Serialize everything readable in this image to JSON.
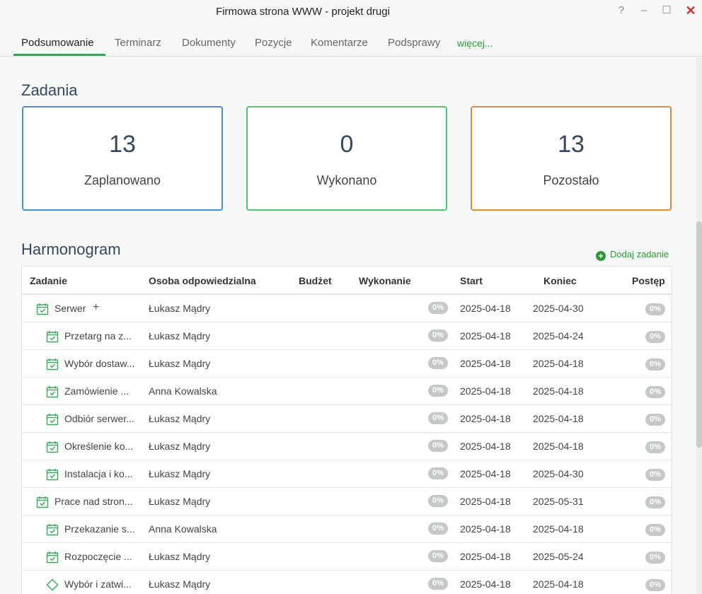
{
  "window": {
    "title": "Firmowa strona WWW - projekt drugi",
    "help": "?",
    "minimize": "–",
    "maximize": "☐",
    "close": "✕"
  },
  "tabs": {
    "items": [
      {
        "label": "Podsumowanie",
        "active": true
      },
      {
        "label": "Terminarz"
      },
      {
        "label": "Dokumenty"
      },
      {
        "label": "Pozycje"
      },
      {
        "label": "Komentarze"
      },
      {
        "label": "Podsprawy"
      }
    ],
    "more": "więcej..."
  },
  "tasks_section": {
    "title": "Zadania",
    "cards": [
      {
        "value": "13",
        "label": "Zaplanowano",
        "color": "#4a90c2"
      },
      {
        "value": "0",
        "label": "Wykonano",
        "color": "#54c06a"
      },
      {
        "value": "13",
        "label": "Pozostało",
        "color": "#d98a3a"
      }
    ]
  },
  "schedule": {
    "title": "Harmonogram",
    "add_task": "Dodaj zadanie",
    "columns": [
      "Zadanie",
      "Osoba odpowiedzialna",
      "Budżet",
      "Wykonanie",
      "Start",
      "Koniec",
      "Postęp"
    ],
    "rows": [
      {
        "name": "Serwer",
        "person": "Łukasz Mądry",
        "exec": "0%",
        "start": "2025-04-18",
        "end": "2025-04-30",
        "progress": "0%",
        "level": 0,
        "icon": "calendar-check-icon",
        "has_add": true,
        "add": "+"
      },
      {
        "name": "Przetarg na z...",
        "person": "Łukasz Mądry",
        "exec": "0%",
        "start": "2025-04-18",
        "end": "2025-04-24",
        "progress": "0%",
        "level": 1,
        "icon": "calendar-check-icon"
      },
      {
        "name": "Wybór dostaw...",
        "person": "Łukasz Mądry",
        "exec": "0%",
        "start": "2025-04-18",
        "end": "2025-04-18",
        "progress": "0%",
        "level": 1,
        "icon": "calendar-check-icon"
      },
      {
        "name": "Zamówienie ...",
        "person": "Anna Kowalska",
        "exec": "0%",
        "start": "2025-04-18",
        "end": "2025-04-18",
        "progress": "0%",
        "level": 1,
        "icon": "calendar-check-icon"
      },
      {
        "name": "Odbiór serwer...",
        "person": "Łukasz Mądry",
        "exec": "0%",
        "start": "2025-04-18",
        "end": "2025-04-18",
        "progress": "0%",
        "level": 1,
        "icon": "calendar-check-icon"
      },
      {
        "name": "Określenie ko...",
        "person": "Łukasz Mądry",
        "exec": "0%",
        "start": "2025-04-18",
        "end": "2025-04-18",
        "progress": "0%",
        "level": 1,
        "icon": "calendar-check-icon"
      },
      {
        "name": "Instalacja i ko...",
        "person": "Łukasz Mądry",
        "exec": "0%",
        "start": "2025-04-18",
        "end": "2025-04-30",
        "progress": "0%",
        "level": 1,
        "icon": "calendar-check-icon"
      },
      {
        "name": "Prace nad stron...",
        "person": "Łukasz Mądry",
        "exec": "0%",
        "start": "2025-04-18",
        "end": "2025-05-31",
        "progress": "0%",
        "level": 0,
        "icon": "calendar-check-icon"
      },
      {
        "name": "Przekazanie s...",
        "person": "Anna Kowalska",
        "exec": "0%",
        "start": "2025-04-18",
        "end": "2025-04-18",
        "progress": "0%",
        "level": 1,
        "icon": "calendar-check-icon"
      },
      {
        "name": "Rozpoczęcie ...",
        "person": "Łukasz Mądry",
        "exec": "0%",
        "start": "2025-04-18",
        "end": "2025-05-24",
        "progress": "0%",
        "level": 1,
        "icon": "calendar-check-icon"
      },
      {
        "name": "Wybór i zatwi...",
        "person": "Łukasz Mądry",
        "exec": "0%",
        "start": "2025-04-18",
        "end": "2025-04-18",
        "progress": "0%",
        "level": 1,
        "icon": "milestone-diamond-icon"
      }
    ]
  },
  "colors": {
    "accent_green": "#3aa65a",
    "icon_green": "#3aa65a",
    "badge_grey": "#c4c8c8"
  }
}
